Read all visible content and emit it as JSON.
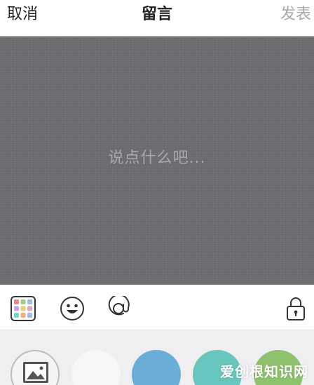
{
  "header": {
    "cancel_label": "取消",
    "title": "留言",
    "send_label": "发表"
  },
  "editor": {
    "placeholder": "说点什么吧..."
  },
  "toolbar": {
    "icons": [
      "color-grid-icon",
      "emoji-icon",
      "mention-icon",
      "lock-icon"
    ]
  },
  "palette": {
    "items": [
      {
        "type": "image",
        "icon": "image-icon"
      },
      {
        "type": "color",
        "color": "#f7f7f8"
      },
      {
        "type": "color",
        "color": "#6aaed8"
      },
      {
        "type": "color",
        "color": "#68c6bf"
      },
      {
        "type": "color",
        "color": "#8fc26c"
      }
    ]
  },
  "watermark": "爱创根知识网",
  "colors": {
    "canvas_bg": "#6c6b6e",
    "placeholder": "#a9a8ab",
    "send_disabled": "#a8a8a8"
  }
}
